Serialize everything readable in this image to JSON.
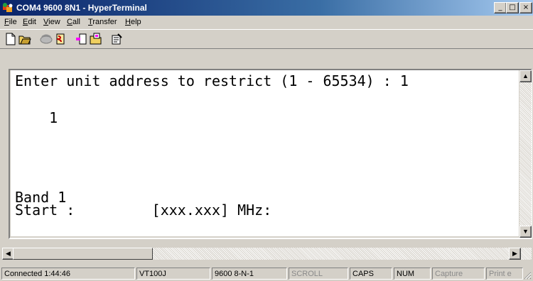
{
  "window": {
    "title": "COM4 9600 8N1 - HyperTerminal",
    "minimize": "_",
    "maximize": "□",
    "close": "×"
  },
  "menu": [
    {
      "label": "File",
      "accel": "F",
      "rest": "ile"
    },
    {
      "label": "Edit",
      "accel": "E",
      "rest": "dit"
    },
    {
      "label": "View",
      "accel": "V",
      "rest": "iew"
    },
    {
      "label": "Call",
      "accel": "C",
      "rest": "all"
    },
    {
      "label": "Transfer",
      "accel": "T",
      "rest": "ransfer"
    },
    {
      "label": "Help",
      "accel": "H",
      "rest": "elp"
    }
  ],
  "toolbar": [
    "new-icon",
    "open-icon",
    "disconnect-icon",
    "dial-icon",
    "send-icon",
    "receive-icon",
    "properties-icon"
  ],
  "terminal": {
    "line1": "Enter unit address to restrict (1 - 65534) : 1",
    "line2": "    1",
    "line3": "Band 1",
    "line4": "Start :         [xxx.xxx] MHz:"
  },
  "status": {
    "connected": "Connected 1:44:46",
    "emulation": "VT100J",
    "settings": "9600 8-N-1",
    "scroll": "SCROLL",
    "caps": "CAPS",
    "num": "NUM",
    "capture": "Capture",
    "print": "Print e"
  }
}
